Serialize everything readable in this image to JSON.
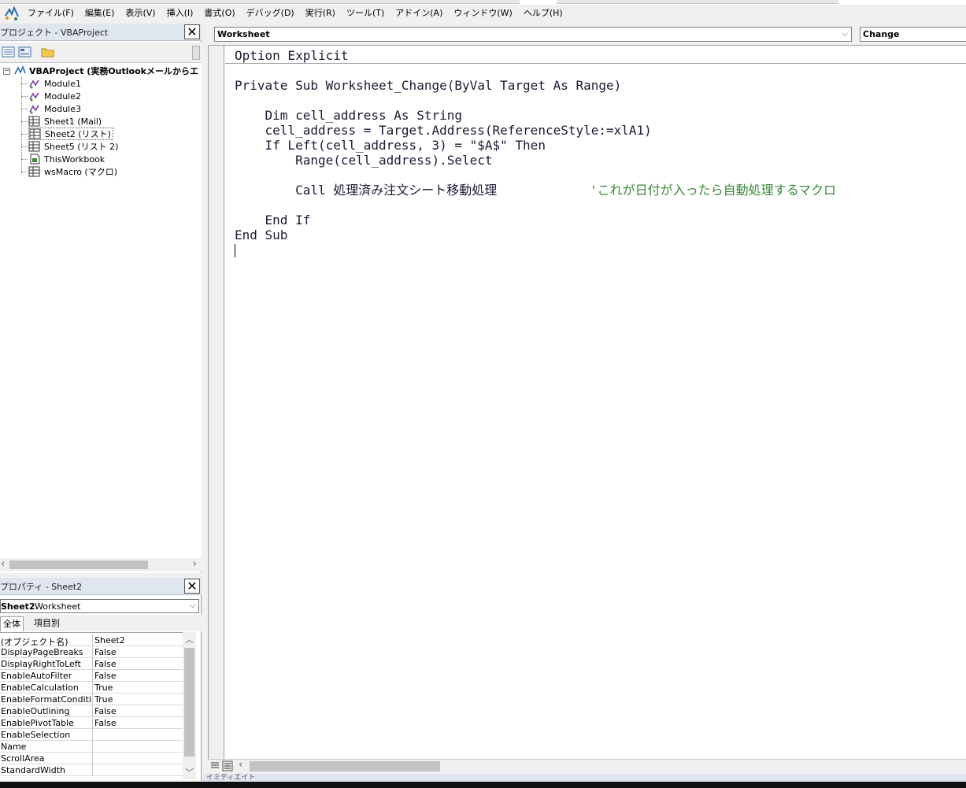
{
  "menubar": {
    "items": [
      "ファイル(F)",
      "編集(E)",
      "表示(V)",
      "挿入(I)",
      "書式(O)",
      "デバッグ(D)",
      "実行(R)",
      "ツール(T)",
      "アドイン(A)",
      "ウィンドウ(W)",
      "ヘルプ(H)"
    ]
  },
  "project_panel": {
    "title": "プロジェクト - VBAProject",
    "close": "✕",
    "root": "VBAProject (実務Outlookメールからエ",
    "items": [
      {
        "label": "Module1",
        "icon": "module-icon"
      },
      {
        "label": "Module2",
        "icon": "module-icon"
      },
      {
        "label": "Module3",
        "icon": "module-icon"
      },
      {
        "label": "Sheet1 (Mail)",
        "icon": "sheet-icon"
      },
      {
        "label": "Sheet2 (リスト)",
        "icon": "sheet-icon"
      },
      {
        "label": "Sheet5 (リスト 2)",
        "icon": "sheet-icon"
      },
      {
        "label": "ThisWorkbook",
        "icon": "workbook-icon"
      },
      {
        "label": "wsMacro (マクロ)",
        "icon": "sheet-icon"
      }
    ]
  },
  "properties_panel": {
    "title": "プロパティ - Sheet2",
    "close": "✕",
    "object_name": "Sheet2",
    "object_type": "Worksheet",
    "tabs": [
      "全体",
      "項目別"
    ],
    "rows": [
      {
        "key": "(オブジェクト名)",
        "value": "Sheet2"
      },
      {
        "key": "DisplayPageBreaks",
        "value": "False"
      },
      {
        "key": "DisplayRightToLeft",
        "value": "False"
      },
      {
        "key": "EnableAutoFilter",
        "value": "False"
      },
      {
        "key": "EnableCalculation",
        "value": "True"
      },
      {
        "key": "EnableFormatConditionsCalculation",
        "value": "True"
      },
      {
        "key": "EnableOutlining",
        "value": "False"
      },
      {
        "key": "EnablePivotTable",
        "value": "False"
      },
      {
        "key": "EnableSelection",
        "value": ""
      },
      {
        "key": "Name",
        "value": ""
      },
      {
        "key": "ScrollArea",
        "value": ""
      },
      {
        "key": "StandardWidth",
        "value": ""
      }
    ]
  },
  "code_window": {
    "object_combo": "Worksheet",
    "procedure_combo": "Change",
    "lines": {
      "l1": "Option Explicit",
      "l2": "Private Sub Worksheet_Change(ByVal Target As Range)",
      "l3": "    Dim cell_address As String",
      "l4": "    cell_address = Target.Address(ReferenceStyle:=xlA1)",
      "l5": "    If Left(cell_address, 3) = \"$A$\" Then",
      "l6": "        Range(cell_address).Select",
      "l7": "        Call 処理済み注文シート移動処理",
      "l7_comment": "'これが日付が入ったら自動処理するマクロ",
      "l8": "    End If",
      "l9": "End Sub"
    }
  },
  "status": "イミディエイト",
  "colors": {
    "comment": "#3a8a3a",
    "title_bar": "#dfe6ef"
  }
}
